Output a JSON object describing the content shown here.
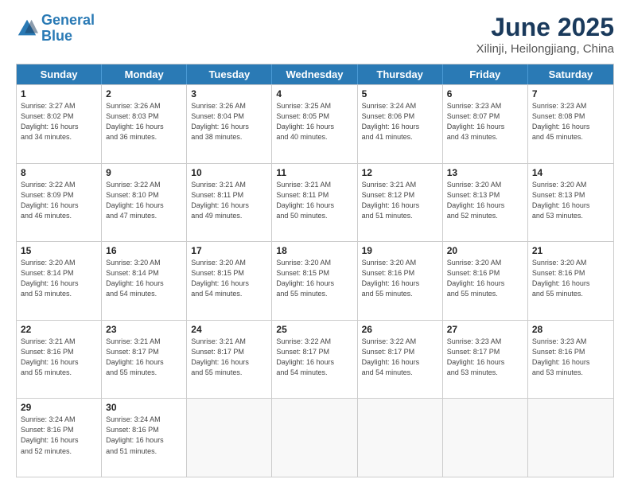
{
  "header": {
    "logo_line1": "General",
    "logo_line2": "Blue",
    "title": "June 2025",
    "location": "Xilinji, Heilongjiang, China"
  },
  "weekdays": [
    "Sunday",
    "Monday",
    "Tuesday",
    "Wednesday",
    "Thursday",
    "Friday",
    "Saturday"
  ],
  "rows": [
    [
      {
        "day": "1",
        "info": "Sunrise: 3:27 AM\nSunset: 8:02 PM\nDaylight: 16 hours\nand 34 minutes."
      },
      {
        "day": "2",
        "info": "Sunrise: 3:26 AM\nSunset: 8:03 PM\nDaylight: 16 hours\nand 36 minutes."
      },
      {
        "day": "3",
        "info": "Sunrise: 3:26 AM\nSunset: 8:04 PM\nDaylight: 16 hours\nand 38 minutes."
      },
      {
        "day": "4",
        "info": "Sunrise: 3:25 AM\nSunset: 8:05 PM\nDaylight: 16 hours\nand 40 minutes."
      },
      {
        "day": "5",
        "info": "Sunrise: 3:24 AM\nSunset: 8:06 PM\nDaylight: 16 hours\nand 41 minutes."
      },
      {
        "day": "6",
        "info": "Sunrise: 3:23 AM\nSunset: 8:07 PM\nDaylight: 16 hours\nand 43 minutes."
      },
      {
        "day": "7",
        "info": "Sunrise: 3:23 AM\nSunset: 8:08 PM\nDaylight: 16 hours\nand 45 minutes."
      }
    ],
    [
      {
        "day": "8",
        "info": "Sunrise: 3:22 AM\nSunset: 8:09 PM\nDaylight: 16 hours\nand 46 minutes."
      },
      {
        "day": "9",
        "info": "Sunrise: 3:22 AM\nSunset: 8:10 PM\nDaylight: 16 hours\nand 47 minutes."
      },
      {
        "day": "10",
        "info": "Sunrise: 3:21 AM\nSunset: 8:11 PM\nDaylight: 16 hours\nand 49 minutes."
      },
      {
        "day": "11",
        "info": "Sunrise: 3:21 AM\nSunset: 8:11 PM\nDaylight: 16 hours\nand 50 minutes."
      },
      {
        "day": "12",
        "info": "Sunrise: 3:21 AM\nSunset: 8:12 PM\nDaylight: 16 hours\nand 51 minutes."
      },
      {
        "day": "13",
        "info": "Sunrise: 3:20 AM\nSunset: 8:13 PM\nDaylight: 16 hours\nand 52 minutes."
      },
      {
        "day": "14",
        "info": "Sunrise: 3:20 AM\nSunset: 8:13 PM\nDaylight: 16 hours\nand 53 minutes."
      }
    ],
    [
      {
        "day": "15",
        "info": "Sunrise: 3:20 AM\nSunset: 8:14 PM\nDaylight: 16 hours\nand 53 minutes."
      },
      {
        "day": "16",
        "info": "Sunrise: 3:20 AM\nSunset: 8:14 PM\nDaylight: 16 hours\nand 54 minutes."
      },
      {
        "day": "17",
        "info": "Sunrise: 3:20 AM\nSunset: 8:15 PM\nDaylight: 16 hours\nand 54 minutes."
      },
      {
        "day": "18",
        "info": "Sunrise: 3:20 AM\nSunset: 8:15 PM\nDaylight: 16 hours\nand 55 minutes."
      },
      {
        "day": "19",
        "info": "Sunrise: 3:20 AM\nSunset: 8:16 PM\nDaylight: 16 hours\nand 55 minutes."
      },
      {
        "day": "20",
        "info": "Sunrise: 3:20 AM\nSunset: 8:16 PM\nDaylight: 16 hours\nand 55 minutes."
      },
      {
        "day": "21",
        "info": "Sunrise: 3:20 AM\nSunset: 8:16 PM\nDaylight: 16 hours\nand 55 minutes."
      }
    ],
    [
      {
        "day": "22",
        "info": "Sunrise: 3:21 AM\nSunset: 8:16 PM\nDaylight: 16 hours\nand 55 minutes."
      },
      {
        "day": "23",
        "info": "Sunrise: 3:21 AM\nSunset: 8:17 PM\nDaylight: 16 hours\nand 55 minutes."
      },
      {
        "day": "24",
        "info": "Sunrise: 3:21 AM\nSunset: 8:17 PM\nDaylight: 16 hours\nand 55 minutes."
      },
      {
        "day": "25",
        "info": "Sunrise: 3:22 AM\nSunset: 8:17 PM\nDaylight: 16 hours\nand 54 minutes."
      },
      {
        "day": "26",
        "info": "Sunrise: 3:22 AM\nSunset: 8:17 PM\nDaylight: 16 hours\nand 54 minutes."
      },
      {
        "day": "27",
        "info": "Sunrise: 3:23 AM\nSunset: 8:17 PM\nDaylight: 16 hours\nand 53 minutes."
      },
      {
        "day": "28",
        "info": "Sunrise: 3:23 AM\nSunset: 8:16 PM\nDaylight: 16 hours\nand 53 minutes."
      }
    ],
    [
      {
        "day": "29",
        "info": "Sunrise: 3:24 AM\nSunset: 8:16 PM\nDaylight: 16 hours\nand 52 minutes."
      },
      {
        "day": "30",
        "info": "Sunrise: 3:24 AM\nSunset: 8:16 PM\nDaylight: 16 hours\nand 51 minutes."
      },
      {
        "day": "",
        "info": ""
      },
      {
        "day": "",
        "info": ""
      },
      {
        "day": "",
        "info": ""
      },
      {
        "day": "",
        "info": ""
      },
      {
        "day": "",
        "info": ""
      }
    ]
  ]
}
